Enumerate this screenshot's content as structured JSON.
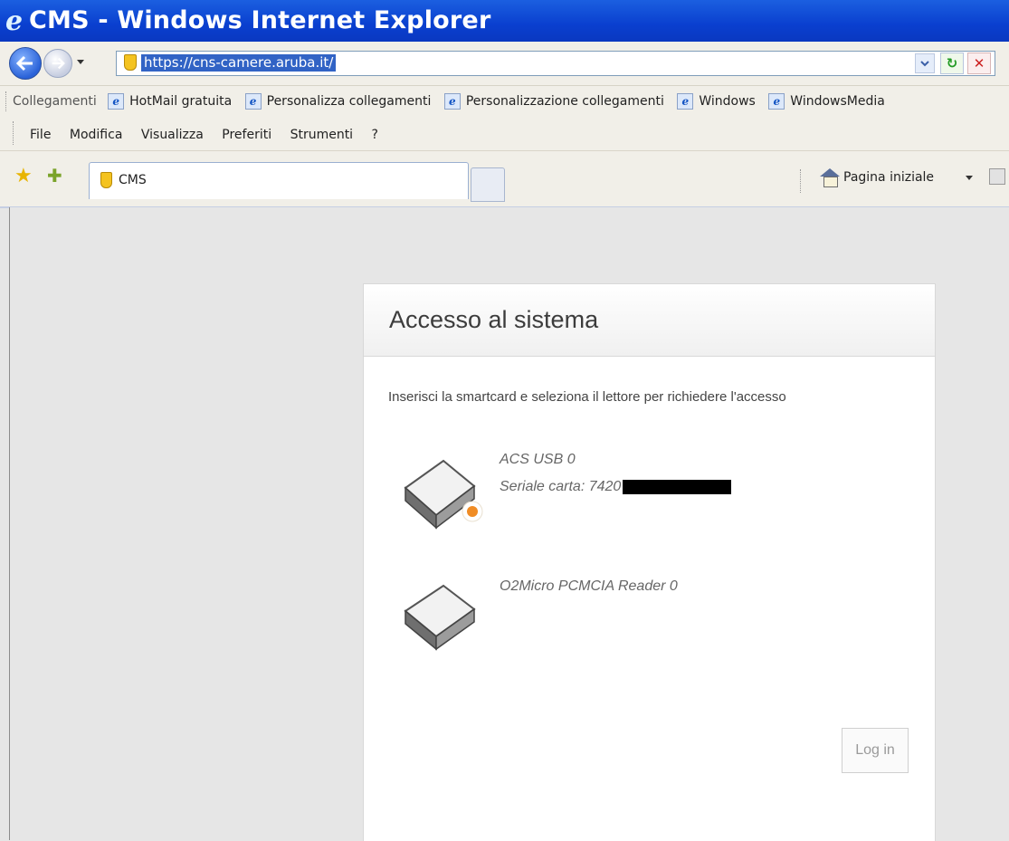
{
  "window": {
    "title": "CMS - Windows Internet Explorer"
  },
  "address": {
    "url": "https://cns-camere.aruba.it/"
  },
  "links_bar": {
    "label": "Collegamenti",
    "links": [
      "HotMail gratuita",
      "Personalizza collegamenti",
      "Personalizzazione collegamenti",
      "Windows",
      "WindowsMedia"
    ]
  },
  "menu": {
    "items": [
      "File",
      "Modifica",
      "Visualizza",
      "Preferiti",
      "Strumenti",
      "?"
    ]
  },
  "tabs": {
    "active": "CMS"
  },
  "command_bar": {
    "home_label": "Pagina iniziale"
  },
  "page": {
    "title": "Accesso al sistema",
    "instructions": "Inserisci la smartcard e seleziona il lettore per richiedere l'accesso",
    "readers": [
      {
        "name": "ACS USB 0",
        "serial_label": "Seriale carta: 7420"
      },
      {
        "name": "O2Micro PCMCIA Reader 0"
      }
    ],
    "login_label": "Log in"
  }
}
